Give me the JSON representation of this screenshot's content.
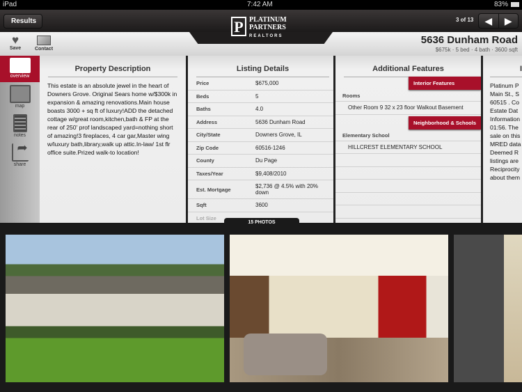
{
  "status_bar": {
    "device": "iPad",
    "time": "7:42 AM",
    "battery": "83%"
  },
  "nav": {
    "back_label": "Results",
    "counter": "3 of 13",
    "prev": "◀",
    "next": "▶"
  },
  "logo": {
    "line1": "PLATINUM",
    "line2": "PARTNERS",
    "line3": "REALTORS"
  },
  "toolbar": {
    "save_label": "Save",
    "contact_label": "Contact"
  },
  "property": {
    "address": "5636 Dunham Road",
    "summary": "$675k · 5 bed · 4 bath · 3600 sqft"
  },
  "sidebar": {
    "items": [
      {
        "label": "overview",
        "icon": "overview-icon"
      },
      {
        "label": "map",
        "icon": "map-icon"
      },
      {
        "label": "notes",
        "icon": "notes-icon"
      },
      {
        "label": "share",
        "icon": "share-icon"
      }
    ]
  },
  "description": {
    "title": "Property Description",
    "text": "This estate is an absolute jewel in the heart of Downers Grove. Original Sears home w/$300k in expansion & amazing renovations.Main house boasts 3000 + sq ft of luxury!ADD the detached cottage w/great room,kitchen,bath & FP at the rear of  250' prof landscaped yard=nothing short of amazing!3 fireplaces, 4 car gar,Master wing w/luxury bath,library,walk up attic.In-law/ 1st flr office suite.Prized walk-to location!"
  },
  "listing": {
    "title": "Listing Details",
    "rows": [
      {
        "k": "Price",
        "v": "$675,000"
      },
      {
        "k": "Beds",
        "v": "5"
      },
      {
        "k": "Baths",
        "v": "4.0"
      },
      {
        "k": "Address",
        "v": "5636 Dunham Road"
      },
      {
        "k": "City/State",
        "v": "Downers Grove, IL"
      },
      {
        "k": "Zip Code",
        "v": "60516-1246"
      },
      {
        "k": "County",
        "v": "Du Page"
      },
      {
        "k": "Taxes/Year",
        "v": "$9,408/2010"
      },
      {
        "k": "Est. Mortgage",
        "v": "$2,736 @ 4.5% with 20% down"
      },
      {
        "k": "Sqft",
        "v": "3600"
      },
      {
        "k": "Lot Size",
        "v": ""
      }
    ]
  },
  "features": {
    "title": "Additional Features",
    "interior_tag": "Interior Features",
    "rooms_label": "Rooms",
    "rooms_value": "Other Room 9 32 x 23 floor Walkout Basement",
    "neighborhood_tag": "Neighborhood & Schools",
    "school_label": "Elementary School",
    "school_value": "HILLCREST ELEMENTARY SCHOOL"
  },
  "disclaimer": {
    "title": "I",
    "text": "Platinum P\nMain St., S\n60515 . Co\nEstate Dat\nInformation\n01:56. The\nsale on this\nMRED data\nDeemed R\nlistings are\nReciprocity\nabout them"
  },
  "photos": {
    "label": "15 PHOTOS"
  },
  "colors": {
    "accent": "#a8102a",
    "nav": "#1f1d1d"
  }
}
